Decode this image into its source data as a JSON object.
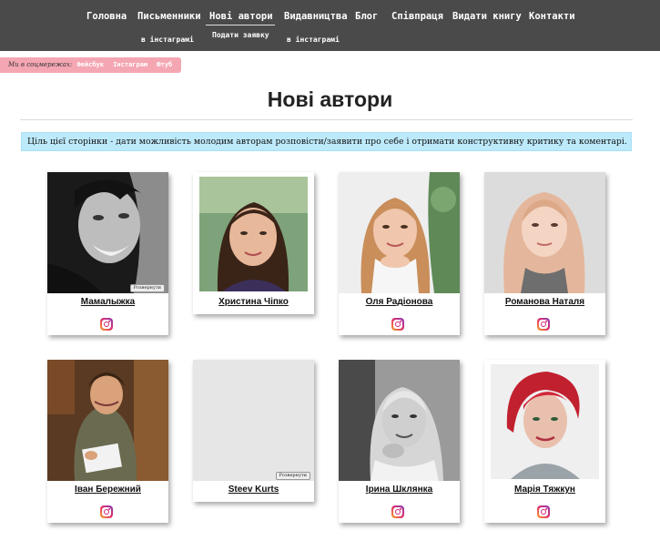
{
  "nav": {
    "items": [
      {
        "label": "Головна"
      },
      {
        "label": "Письменники"
      },
      {
        "label": "Нові автори"
      },
      {
        "label": "Видавництва"
      },
      {
        "label": "Блог"
      },
      {
        "label": "Співпраця"
      },
      {
        "label": "Видати книгу"
      },
      {
        "label": "Контакти"
      }
    ],
    "sub": [
      "в інстаграмі",
      "Подати заявку",
      "в інстаграмі"
    ]
  },
  "social": {
    "label": "Ми в соцмережах:",
    "links": [
      "Фейсбук",
      "Інстаграм",
      "Ютуб"
    ]
  },
  "page": {
    "title": "Нові автори",
    "banner": "Ціль цієї сторінки - дати можливість молодим авторам розповісти/заявити про себе і отримати конструктивну критику та коментарі."
  },
  "enlarge_label": "Розвернути",
  "authors": [
    {
      "name": "Мамалыжка"
    },
    {
      "name": "Христина Чіпко"
    },
    {
      "name": "Оля Радіонова"
    },
    {
      "name": "Романова Наталя"
    },
    {
      "name": "Іван Бережний"
    },
    {
      "name": "Steev Kurts"
    },
    {
      "name": "Ірина Шклянка"
    },
    {
      "name": "Марія Тяжкун"
    }
  ],
  "colors": {
    "topbar": "#4a4a4a",
    "social_bg": "#f4a7b3",
    "banner_bg": "#bdeafb"
  }
}
